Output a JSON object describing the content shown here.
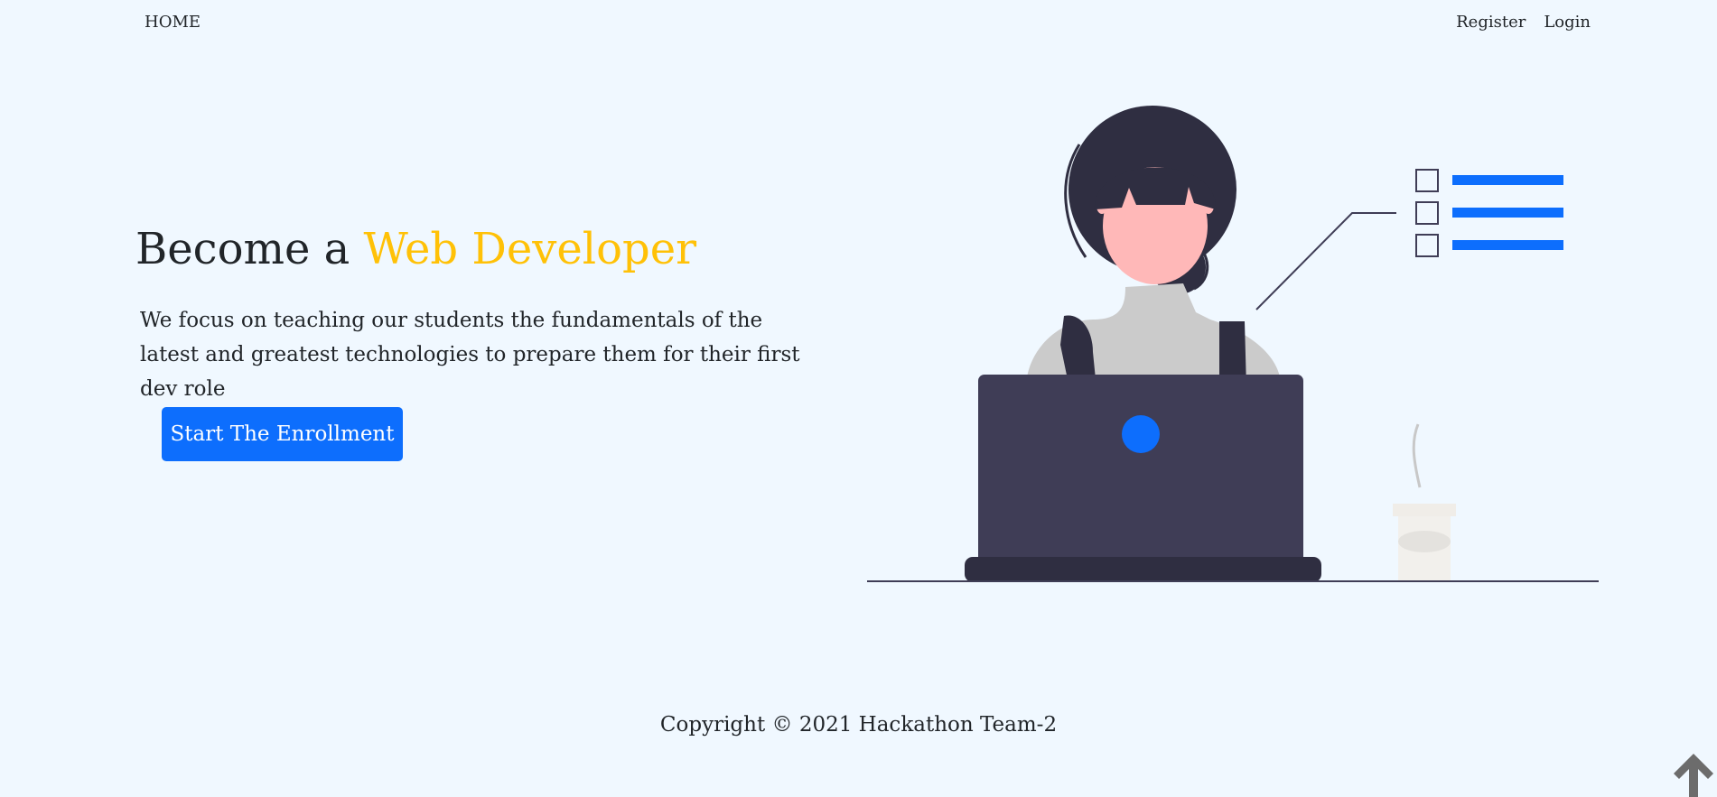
{
  "nav": {
    "home_label": "HOME",
    "register_label": "Register",
    "login_label": "Login"
  },
  "hero": {
    "title_prefix": "Become a ",
    "title_accent": "Web Developer",
    "description": "We focus on teaching our students the fundamentals of the latest and greatest technologies to prepare them for their first dev role",
    "cta_label": "Start The Enrollment"
  },
  "footer": {
    "copyright": "Copyright © 2021 Hackathon Team-2"
  },
  "icons": {
    "back_to_top": "arrow-up-icon",
    "illustration": "woman-at-laptop-illustration"
  },
  "colors": {
    "background": "#f0f8ff",
    "accent": "#ffc107",
    "primary": "#0d6efd",
    "text": "#212529"
  }
}
